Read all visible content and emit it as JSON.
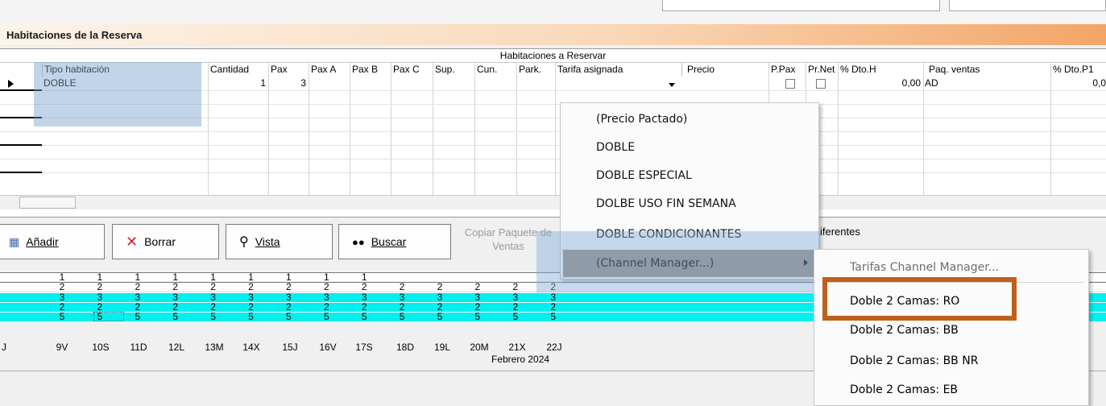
{
  "section": {
    "title": "Habitaciones de la Reserva"
  },
  "grid": {
    "group_header": "Habitaciones a Reservar",
    "columns": [
      "Tipo habitación",
      "Cantidad",
      "Pax",
      "Pax A",
      "Pax B",
      "Pax C",
      "Sup.",
      "Cun.",
      "Park.",
      "Tarifa asignada",
      "Precio",
      "P.Pax",
      "Pr.Net",
      "% Dto.H",
      "Paq. ventas",
      "% Dto.P1"
    ],
    "row": {
      "tipo": "DOBLE",
      "cantidad": "1",
      "pax": "3",
      "dto_h": "0,00",
      "paq_ventas": "AD",
      "dto_p1": "0,0"
    }
  },
  "buttons": {
    "anadir": "Añadir",
    "borrar": "Borrar",
    "vista": "Vista",
    "buscar": "Buscar",
    "copiar": "Copiar Paquete de Ventas"
  },
  "diferentes_label": "iferentes",
  "availability": {
    "rows": [
      {
        "style": "white",
        "values": [
          "1",
          "1",
          "1",
          "1",
          "1",
          "1",
          "1",
          "1",
          "1"
        ]
      },
      {
        "style": "white",
        "values": [
          "2",
          "2",
          "2",
          "2",
          "2",
          "2",
          "2",
          "2",
          "2",
          "2",
          "2",
          "2",
          "2",
          "2"
        ]
      },
      {
        "style": "cyan",
        "values": [
          "3",
          "3",
          "3",
          "3",
          "3",
          "3",
          "3",
          "3",
          "3",
          "3",
          "3",
          "3",
          "3",
          "3"
        ]
      },
      {
        "style": "cyan",
        "values": [
          "2",
          "2",
          "2",
          "2",
          "2",
          "2",
          "2",
          "2",
          "2",
          "2",
          "2",
          "2",
          "2",
          "2"
        ]
      },
      {
        "style": "cyan",
        "values": [
          "5",
          "5",
          "5",
          "5",
          "5",
          "5",
          "5",
          "5",
          "5",
          "5",
          "5",
          "5",
          "5",
          "5"
        ]
      }
    ],
    "days": [
      "J",
      "9V",
      "10S",
      "11D",
      "12L",
      "13M",
      "14X",
      "15J",
      "16V",
      "17S",
      "18D",
      "19L",
      "20M",
      "21X",
      "22J"
    ],
    "month": "Febrero 2024"
  },
  "menu": {
    "items": [
      "(Precio Pactado)",
      "DOBLE",
      "DOBLE ESPECIAL",
      "DOLBE USO FIN SEMANA",
      "DOBLE CONDICIONANTES",
      "(Channel Manager...)"
    ]
  },
  "submenu": {
    "header": "Tarifas Channel Manager...",
    "items": [
      "Doble 2 Camas: RO",
      "Doble 2 Camas: BB",
      "Doble 2 Camas: BB NR",
      "Doble 2 Camas: EB"
    ]
  },
  "colors": {
    "highlight": "#c0601b",
    "availability_cyan": "#00f0f0",
    "menu_selected": "#9a8f84"
  },
  "icons": {
    "anadir": "add-rows-icon",
    "borrar": "red-x-icon",
    "vista": "magnifier-icon",
    "buscar": "binoculars-icon"
  }
}
